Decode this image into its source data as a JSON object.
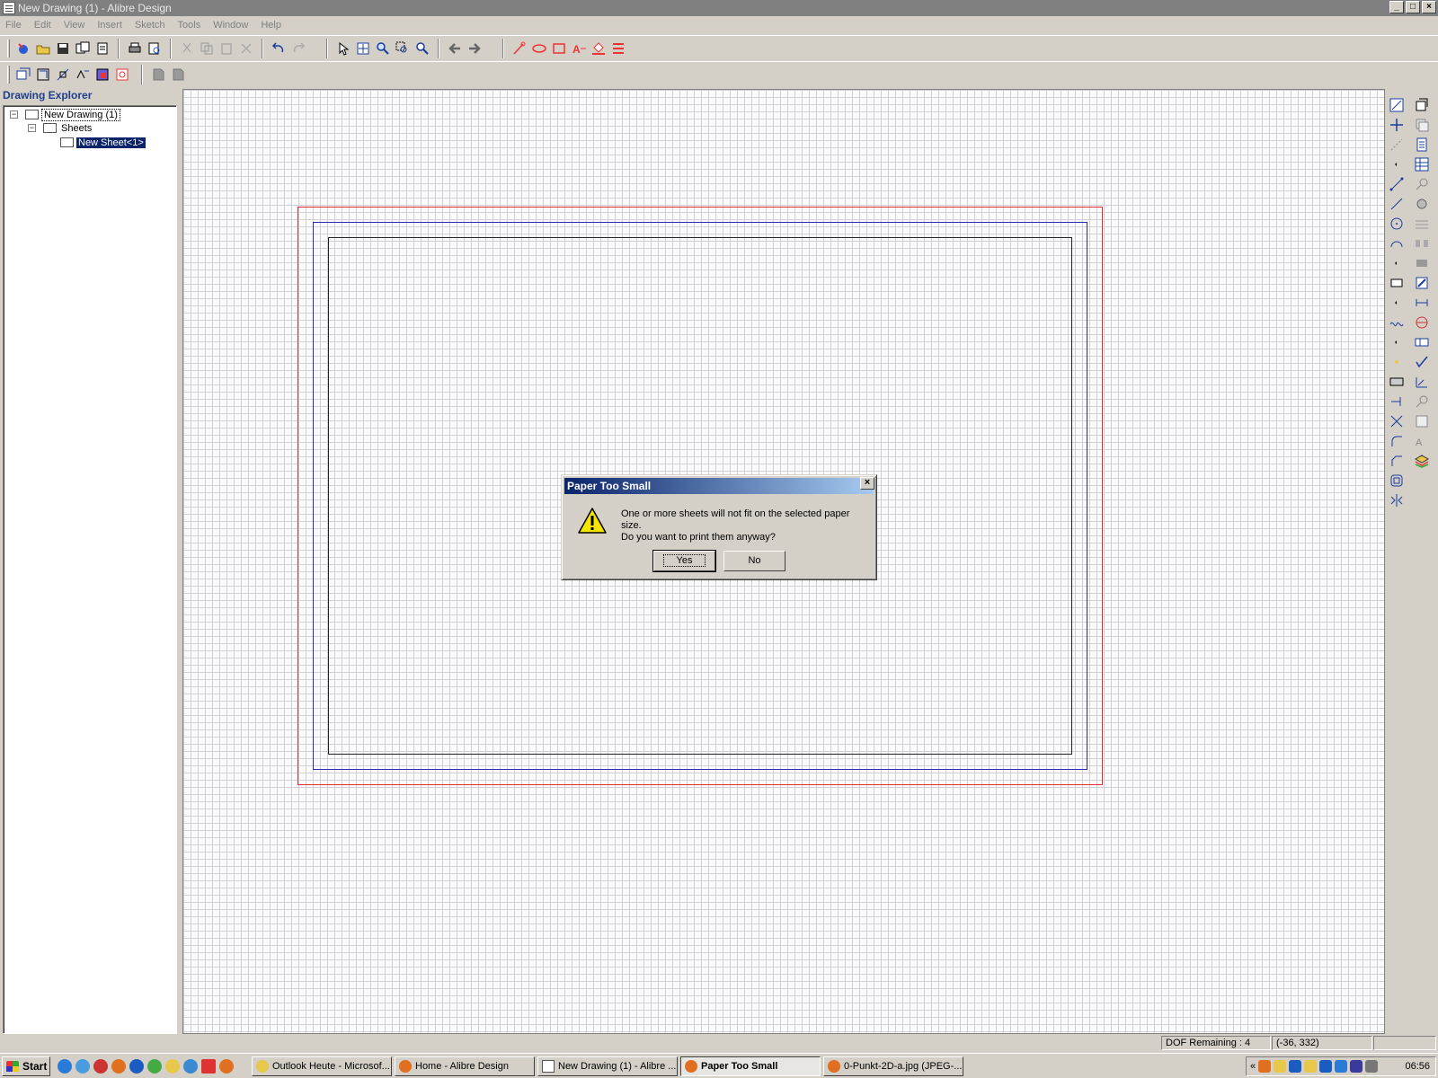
{
  "window": {
    "title": "New Drawing (1) - Alibre Design",
    "controls": [
      "_",
      "□",
      "×"
    ]
  },
  "menu": [
    "File",
    "Edit",
    "View",
    "Insert",
    "Sketch",
    "Tools",
    "Window",
    "Help"
  ],
  "explorer": {
    "title": "Drawing Explorer",
    "root": "New Drawing (1)",
    "folder": "Sheets",
    "sheet": "New Sheet<1>"
  },
  "dialog": {
    "title": "Paper Too Small",
    "line1": "One or more sheets will not fit on the selected paper size.",
    "line2": "Do you want to print them anyway?",
    "yes": "Yes",
    "no": "No",
    "close": "×"
  },
  "status": {
    "dof": "DOF Remaining : 4",
    "coords": "(-36, 332)"
  },
  "taskbar": {
    "start": "Start",
    "tasks": [
      "Outlook Heute - Microsof...",
      "Home - Alibre Design",
      "New Drawing (1) - Alibre ...",
      "Paper Too Small",
      "0-Punkt-2D-a.jpg (JPEG-..."
    ],
    "tray_chevron": "«",
    "clock": "06:56"
  },
  "colors": {
    "sheet_outer": "#e0303a",
    "sheet_mid": "#2d2db4",
    "sheet_inner": "#222222",
    "selection": "#0a246a"
  }
}
